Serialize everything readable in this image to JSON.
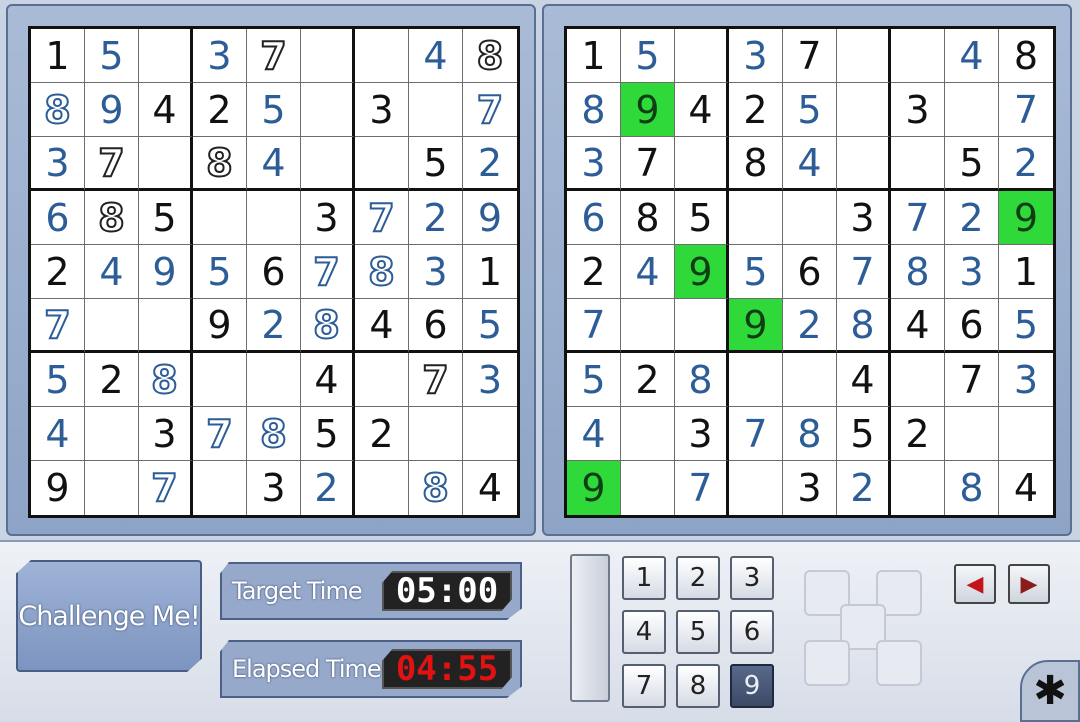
{
  "left_board": {
    "cells": [
      [
        {
          "v": "1",
          "s": "given"
        },
        {
          "v": "5",
          "s": "entered"
        },
        {
          "v": "",
          "s": ""
        },
        {
          "v": "3",
          "s": "entered"
        },
        {
          "v": "7",
          "s": "outline-dark"
        },
        {
          "v": "",
          "s": ""
        },
        {
          "v": "",
          "s": ""
        },
        {
          "v": "4",
          "s": "entered"
        },
        {
          "v": "8",
          "s": "outline-dark"
        }
      ],
      [
        {
          "v": "8",
          "s": "outline"
        },
        {
          "v": "9",
          "s": "entered"
        },
        {
          "v": "4",
          "s": "given"
        },
        {
          "v": "2",
          "s": "given"
        },
        {
          "v": "5",
          "s": "entered"
        },
        {
          "v": "",
          "s": ""
        },
        {
          "v": "3",
          "s": "given"
        },
        {
          "v": "",
          "s": ""
        },
        {
          "v": "7",
          "s": "outline"
        }
      ],
      [
        {
          "v": "3",
          "s": "entered"
        },
        {
          "v": "7",
          "s": "outline-dark"
        },
        {
          "v": "",
          "s": ""
        },
        {
          "v": "8",
          "s": "outline-dark"
        },
        {
          "v": "4",
          "s": "entered"
        },
        {
          "v": "",
          "s": ""
        },
        {
          "v": "",
          "s": ""
        },
        {
          "v": "5",
          "s": "given"
        },
        {
          "v": "2",
          "s": "entered"
        }
      ],
      [
        {
          "v": "6",
          "s": "entered"
        },
        {
          "v": "8",
          "s": "outline-dark"
        },
        {
          "v": "5",
          "s": "given"
        },
        {
          "v": "",
          "s": ""
        },
        {
          "v": "",
          "s": ""
        },
        {
          "v": "3",
          "s": "given"
        },
        {
          "v": "7",
          "s": "outline"
        },
        {
          "v": "2",
          "s": "entered"
        },
        {
          "v": "9",
          "s": "entered"
        }
      ],
      [
        {
          "v": "2",
          "s": "given"
        },
        {
          "v": "4",
          "s": "entered"
        },
        {
          "v": "9",
          "s": "entered"
        },
        {
          "v": "5",
          "s": "entered"
        },
        {
          "v": "6",
          "s": "given"
        },
        {
          "v": "7",
          "s": "outline"
        },
        {
          "v": "8",
          "s": "outline"
        },
        {
          "v": "3",
          "s": "entered"
        },
        {
          "v": "1",
          "s": "given"
        }
      ],
      [
        {
          "v": "7",
          "s": "outline"
        },
        {
          "v": "",
          "s": ""
        },
        {
          "v": "",
          "s": ""
        },
        {
          "v": "9",
          "s": "given"
        },
        {
          "v": "2",
          "s": "entered"
        },
        {
          "v": "8",
          "s": "outline"
        },
        {
          "v": "4",
          "s": "given"
        },
        {
          "v": "6",
          "s": "given"
        },
        {
          "v": "5",
          "s": "entered"
        }
      ],
      [
        {
          "v": "5",
          "s": "entered"
        },
        {
          "v": "2",
          "s": "given"
        },
        {
          "v": "8",
          "s": "outline"
        },
        {
          "v": "",
          "s": ""
        },
        {
          "v": "",
          "s": ""
        },
        {
          "v": "4",
          "s": "given"
        },
        {
          "v": "",
          "s": ""
        },
        {
          "v": "7",
          "s": "outline-dark"
        },
        {
          "v": "3",
          "s": "entered"
        }
      ],
      [
        {
          "v": "4",
          "s": "entered"
        },
        {
          "v": "",
          "s": ""
        },
        {
          "v": "3",
          "s": "given"
        },
        {
          "v": "7",
          "s": "outline"
        },
        {
          "v": "8",
          "s": "outline"
        },
        {
          "v": "5",
          "s": "given"
        },
        {
          "v": "2",
          "s": "given"
        },
        {
          "v": "",
          "s": ""
        },
        {
          "v": "",
          "s": ""
        }
      ],
      [
        {
          "v": "9",
          "s": "given"
        },
        {
          "v": "",
          "s": ""
        },
        {
          "v": "7",
          "s": "outline"
        },
        {
          "v": "",
          "s": ""
        },
        {
          "v": "3",
          "s": "given"
        },
        {
          "v": "2",
          "s": "entered"
        },
        {
          "v": "",
          "s": ""
        },
        {
          "v": "8",
          "s": "outline"
        },
        {
          "v": "4",
          "s": "given"
        }
      ]
    ]
  },
  "right_board": {
    "cells": [
      [
        {
          "v": "1",
          "s": "given"
        },
        {
          "v": "5",
          "s": "entered"
        },
        {
          "v": "",
          "s": ""
        },
        {
          "v": "3",
          "s": "entered"
        },
        {
          "v": "7",
          "s": "given"
        },
        {
          "v": "",
          "s": ""
        },
        {
          "v": "",
          "s": ""
        },
        {
          "v": "4",
          "s": "entered"
        },
        {
          "v": "8",
          "s": "given"
        }
      ],
      [
        {
          "v": "8",
          "s": "entered"
        },
        {
          "v": "9",
          "s": "entered hl"
        },
        {
          "v": "4",
          "s": "given"
        },
        {
          "v": "2",
          "s": "given"
        },
        {
          "v": "5",
          "s": "entered"
        },
        {
          "v": "",
          "s": ""
        },
        {
          "v": "3",
          "s": "given"
        },
        {
          "v": "",
          "s": ""
        },
        {
          "v": "7",
          "s": "entered"
        }
      ],
      [
        {
          "v": "3",
          "s": "entered"
        },
        {
          "v": "7",
          "s": "given"
        },
        {
          "v": "",
          "s": ""
        },
        {
          "v": "8",
          "s": "given"
        },
        {
          "v": "4",
          "s": "entered"
        },
        {
          "v": "",
          "s": ""
        },
        {
          "v": "",
          "s": ""
        },
        {
          "v": "5",
          "s": "given"
        },
        {
          "v": "2",
          "s": "entered"
        }
      ],
      [
        {
          "v": "6",
          "s": "entered"
        },
        {
          "v": "8",
          "s": "given"
        },
        {
          "v": "5",
          "s": "given"
        },
        {
          "v": "",
          "s": ""
        },
        {
          "v": "",
          "s": ""
        },
        {
          "v": "3",
          "s": "given"
        },
        {
          "v": "7",
          "s": "entered"
        },
        {
          "v": "2",
          "s": "entered"
        },
        {
          "v": "9",
          "s": "entered hl"
        }
      ],
      [
        {
          "v": "2",
          "s": "given"
        },
        {
          "v": "4",
          "s": "entered"
        },
        {
          "v": "9",
          "s": "entered hl"
        },
        {
          "v": "5",
          "s": "entered"
        },
        {
          "v": "6",
          "s": "given"
        },
        {
          "v": "7",
          "s": "entered"
        },
        {
          "v": "8",
          "s": "entered"
        },
        {
          "v": "3",
          "s": "entered"
        },
        {
          "v": "1",
          "s": "given"
        }
      ],
      [
        {
          "v": "7",
          "s": "entered"
        },
        {
          "v": "",
          "s": ""
        },
        {
          "v": "",
          "s": ""
        },
        {
          "v": "9",
          "s": "given hl"
        },
        {
          "v": "2",
          "s": "entered"
        },
        {
          "v": "8",
          "s": "entered"
        },
        {
          "v": "4",
          "s": "given"
        },
        {
          "v": "6",
          "s": "given"
        },
        {
          "v": "5",
          "s": "entered"
        }
      ],
      [
        {
          "v": "5",
          "s": "entered"
        },
        {
          "v": "2",
          "s": "given"
        },
        {
          "v": "8",
          "s": "entered"
        },
        {
          "v": "",
          "s": ""
        },
        {
          "v": "",
          "s": ""
        },
        {
          "v": "4",
          "s": "given"
        },
        {
          "v": "",
          "s": ""
        },
        {
          "v": "7",
          "s": "given"
        },
        {
          "v": "3",
          "s": "entered"
        }
      ],
      [
        {
          "v": "4",
          "s": "entered"
        },
        {
          "v": "",
          "s": ""
        },
        {
          "v": "3",
          "s": "given"
        },
        {
          "v": "7",
          "s": "entered"
        },
        {
          "v": "8",
          "s": "entered"
        },
        {
          "v": "5",
          "s": "given"
        },
        {
          "v": "2",
          "s": "given"
        },
        {
          "v": "",
          "s": ""
        },
        {
          "v": "",
          "s": ""
        }
      ],
      [
        {
          "v": "9",
          "s": "given hl"
        },
        {
          "v": "",
          "s": ""
        },
        {
          "v": "7",
          "s": "entered"
        },
        {
          "v": "",
          "s": ""
        },
        {
          "v": "3",
          "s": "given"
        },
        {
          "v": "2",
          "s": "entered"
        },
        {
          "v": "",
          "s": ""
        },
        {
          "v": "8",
          "s": "entered"
        },
        {
          "v": "4",
          "s": "given"
        }
      ]
    ]
  },
  "controls": {
    "challenge_label": "Challenge Me!",
    "target_time_label": "Target Time",
    "target_time_value": "05:00",
    "elapsed_time_label": "Elapsed Time",
    "elapsed_time_value": "04:55",
    "numpad": [
      "1",
      "2",
      "3",
      "4",
      "5",
      "6",
      "7",
      "8",
      "9"
    ],
    "selected_number": "9",
    "prev_icon": "left-arrow-icon",
    "next_icon": "right-arrow-icon",
    "settings_icon": "asterisk-icon"
  },
  "colors": {
    "highlight": "#2fd93a",
    "entered_digit": "#2c5d97",
    "elapsed_digits": "#e21212"
  }
}
